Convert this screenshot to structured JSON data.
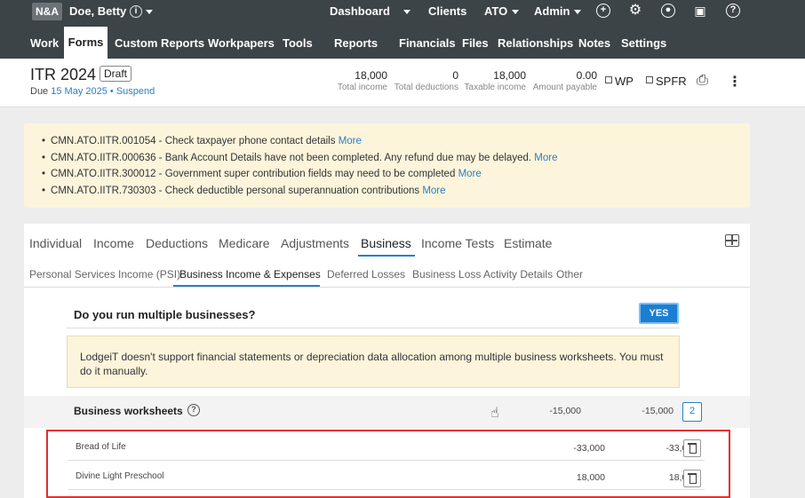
{
  "topbar": {
    "badge": "N&A",
    "client": "Doe, Betty",
    "nav": [
      "Dashboard",
      "Clients",
      "ATO",
      "Admin"
    ],
    "icons": [
      "add-icon",
      "gear-icon",
      "user-icon",
      "gift-icon",
      "help-icon"
    ]
  },
  "subnav": {
    "items": [
      "Work",
      "Forms",
      "Custom Reports",
      "Workpapers",
      "Tools",
      "Reports",
      "Financials",
      "Files",
      "Relationships",
      "Notes",
      "Settings"
    ],
    "active": "Forms"
  },
  "header": {
    "title": "ITR 2024",
    "status": "Draft",
    "due_prefix": "Due",
    "due_date": "15 May 2025",
    "suspend": "Suspend",
    "summary": [
      {
        "value": "18,000",
        "label": "Total income"
      },
      {
        "value": "0",
        "label": "Total deductions"
      },
      {
        "value": "18,000",
        "label": "Taxable income"
      },
      {
        "value": "0.00",
        "label": "Amount payable"
      }
    ],
    "checks": [
      "WP",
      "SPFR"
    ]
  },
  "alerts": [
    {
      "text": "CMN.ATO.IITR.001054 - Check taxpayer phone contact details",
      "more": "More"
    },
    {
      "text": "CMN.ATO.IITR.000636 - Bank Account Details have not been completed. Any refund due may be delayed.",
      "more": "More"
    },
    {
      "text": "CMN.ATO.IITR.300012 - Government super contribution fields may need to be completed",
      "more": "More"
    },
    {
      "text": "CMN.ATO.IITR.730303 - Check deductible personal superannuation contributions",
      "more": "More"
    }
  ],
  "tabs": [
    "Individual",
    "Income",
    "Deductions",
    "Medicare",
    "Adjustments",
    "Business",
    "Income Tests",
    "Estimate"
  ],
  "active_tab": "Business",
  "subtabs": [
    "Personal Services Income (PSI)",
    "Business Income & Expenses",
    "Deferred Losses",
    "Business Loss Activity Details",
    "Other"
  ],
  "active_subtab": "Business Income & Expenses",
  "question": {
    "text": "Do you run multiple businesses?",
    "answer": "YES"
  },
  "warning": "LodgeiT doesn't support financial statements or depreciation data allocation among multiple business worksheets. You must do it manually.",
  "worksheets": {
    "title": "Business worksheets",
    "total_a": "-15,000",
    "total_b": "-15,000",
    "count": "2",
    "rows": [
      {
        "name": "Bread of Life",
        "a": "-33,000",
        "b": "-33,000"
      },
      {
        "name": "Divine Light Preschool",
        "a": "18,000",
        "b": "18,000"
      }
    ]
  }
}
